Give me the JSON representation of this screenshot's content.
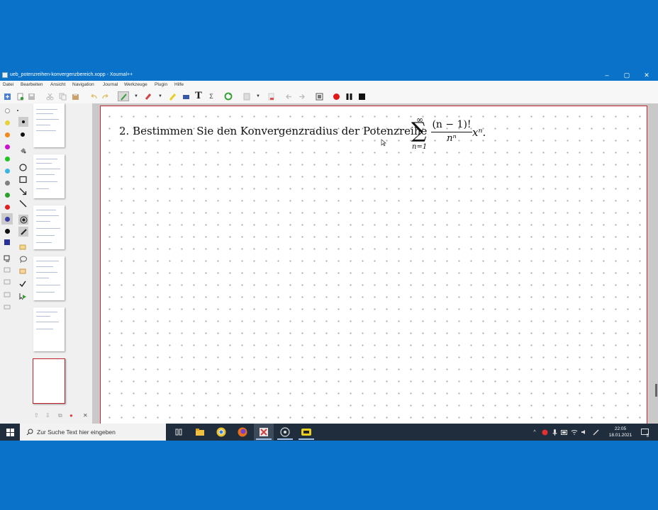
{
  "window": {
    "title": "ueb_potenzreihen-konvergenzbereich.xopp - Xournal++",
    "controls": [
      "–",
      "▢",
      "✕"
    ]
  },
  "menu": [
    "Datei",
    "Bearbeiten",
    "Ansicht",
    "Navigation",
    "Journal",
    "Werkzeuge",
    "Plugin",
    "Hilfe"
  ],
  "toolbar_icons": [
    "new-file-icon",
    "open-file-icon",
    "save-icon",
    "cut-icon",
    "copy-icon",
    "paste-icon",
    "undo-icon",
    "redo-icon",
    "pen-icon",
    "eraser-icon",
    "highlighter-icon",
    "image-icon",
    "text-icon",
    "latex-icon",
    "refresh-icon",
    "select-rect-icon",
    "delete-icon",
    "back-icon",
    "forward-icon",
    "fullscreen-icon",
    "record-icon",
    "pause-icon",
    "stop-icon"
  ],
  "colors": {
    "palette": [
      "#ffffff",
      "#e6d33a",
      "#f28a1e",
      "#cc11cc",
      "#23c323",
      "#3ab4e0",
      "#808080",
      "#2aa22a",
      "#e02020",
      "#3b3fa3",
      "#111111",
      "#2a3199"
    ],
    "page_border": "#c0262e",
    "taskbar": "#1f2d3d",
    "desktop": "#0a73c9"
  },
  "canvas": {
    "task_text": "2. Bestimmen Sie den Konvergenzradius der Potenzreihe",
    "formula": {
      "upper": "∞",
      "sigma": "∑",
      "lower": "n=1",
      "numerator": "(n − 1)!",
      "denominator": "nⁿ",
      "tail": "xⁿ."
    }
  },
  "preview": {
    "pages": 6,
    "selected_page": 6
  },
  "taskbar": {
    "search_placeholder": "Zur Suche Text hier eingeben",
    "time": "22:05",
    "date": "18.01.2021",
    "notification_count": "5"
  }
}
